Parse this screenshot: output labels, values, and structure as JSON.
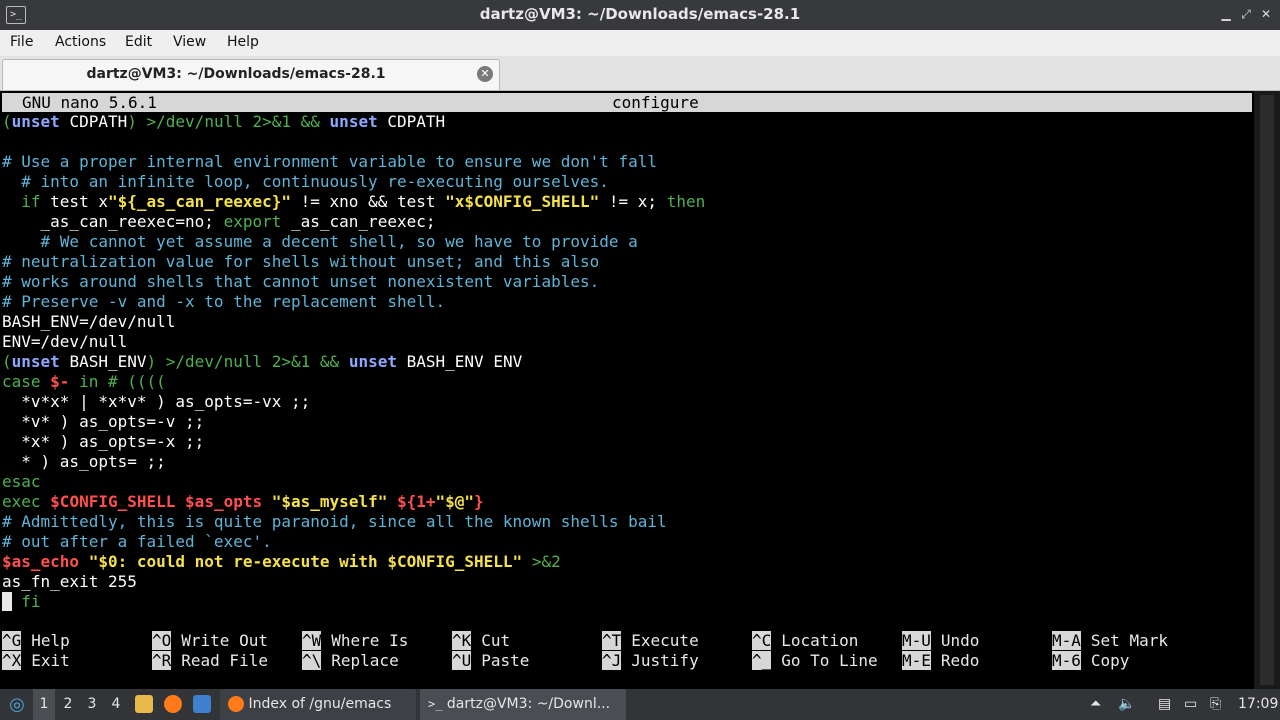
{
  "window": {
    "title": "dartz@VM3: ~/Downloads/emacs-28.1",
    "icon_glyph": ">_"
  },
  "menu": [
    "File",
    "Actions",
    "Edit",
    "View",
    "Help"
  ],
  "tab": {
    "label": "dartz@VM3: ~/Downloads/emacs-28.1"
  },
  "nano": {
    "version": "GNU nano 5.6.1",
    "filename": "configure"
  },
  "code": [
    [
      [
        "(",
        "op"
      ],
      [
        "unset",
        "bk"
      ],
      [
        " CDPATH",
        "n"
      ],
      [
        ") >/dev/null 2>&1 && ",
        "op"
      ],
      [
        "unset",
        "bk"
      ],
      [
        " CDPATH",
        "n"
      ]
    ],
    [
      [
        "",
        "n"
      ]
    ],
    [
      [
        "# Use a proper internal environment variable to ensure we don't fall",
        "com"
      ]
    ],
    [
      [
        "  # into an infinite loop, continuously re-executing ourselves.",
        "com"
      ]
    ],
    [
      [
        "  ",
        "n"
      ],
      [
        "if",
        "kw"
      ],
      [
        " test x",
        "n"
      ],
      [
        "\"${_as_can_reexec}\"",
        "str"
      ],
      [
        " != xno && test ",
        "n"
      ],
      [
        "\"x$CONFIG_SHELL\"",
        "str"
      ],
      [
        " != x; ",
        "n"
      ],
      [
        "then",
        "kw"
      ]
    ],
    [
      [
        "    _as_can_reexec=no; ",
        "n"
      ],
      [
        "export",
        "kw"
      ],
      [
        " _as_can_reexec;",
        "n"
      ]
    ],
    [
      [
        "    # We cannot yet assume a decent shell, so we have to provide a",
        "com"
      ]
    ],
    [
      [
        "# neutralization value for shells without unset; and this also",
        "com"
      ]
    ],
    [
      [
        "# works around shells that cannot unset nonexistent variables.",
        "com"
      ]
    ],
    [
      [
        "# Preserve -v and -x to the replacement shell.",
        "com"
      ]
    ],
    [
      [
        "BASH_ENV=/dev/null",
        "n"
      ]
    ],
    [
      [
        "ENV=/dev/null",
        "n"
      ]
    ],
    [
      [
        "(",
        "op"
      ],
      [
        "unset",
        "bk"
      ],
      [
        " BASH_ENV",
        "n"
      ],
      [
        ") >/dev/null 2>&1 && ",
        "op"
      ],
      [
        "unset",
        "bk"
      ],
      [
        " BASH_ENV ENV",
        "n"
      ]
    ],
    [
      [
        "case",
        "kw"
      ],
      [
        " ",
        "n"
      ],
      [
        "$-",
        "var"
      ],
      [
        " ",
        "n"
      ],
      [
        "in",
        "kw"
      ],
      [
        " # ((((",
        "op"
      ]
    ],
    [
      [
        "  *v*x* | *x*v* ) as_opts=-vx ;;",
        "n"
      ]
    ],
    [
      [
        "  *v* ) as_opts=-v ;;",
        "n"
      ]
    ],
    [
      [
        "  *x* ) as_opts=-x ;;",
        "n"
      ]
    ],
    [
      [
        "  * ) as_opts= ;;",
        "n"
      ]
    ],
    [
      [
        "esac",
        "kw"
      ]
    ],
    [
      [
        "exec",
        "kw"
      ],
      [
        " ",
        "n"
      ],
      [
        "$CONFIG_SHELL",
        "var"
      ],
      [
        " ",
        "n"
      ],
      [
        "$as_opts",
        "var"
      ],
      [
        " ",
        "n"
      ],
      [
        "\"$as_myself\"",
        "str"
      ],
      [
        " ",
        "n"
      ],
      [
        "${1+",
        "var"
      ],
      [
        "\"$@\"",
        "str"
      ],
      [
        "}",
        "var"
      ]
    ],
    [
      [
        "# Admittedly, this is quite paranoid, since all the known shells bail",
        "com"
      ]
    ],
    [
      [
        "# out after a failed `exec'.",
        "com"
      ]
    ],
    [
      [
        "$as_echo",
        "var"
      ],
      [
        " ",
        "n"
      ],
      [
        "\"$0: could not re-execute with $CONFIG_SHELL\"",
        "str"
      ],
      [
        " >&2",
        "op"
      ]
    ],
    [
      [
        "as_fn_exit 255",
        "n"
      ]
    ],
    [
      [
        " ",
        "cur"
      ],
      [
        " fi",
        "kw"
      ]
    ]
  ],
  "shortcuts": [
    [
      {
        "key": "^G",
        "label": "Help"
      },
      {
        "key": "^O",
        "label": "Write Out"
      },
      {
        "key": "^W",
        "label": "Where Is"
      },
      {
        "key": "^K",
        "label": "Cut"
      },
      {
        "key": "^T",
        "label": "Execute"
      },
      {
        "key": "^C",
        "label": "Location"
      },
      {
        "key": "M-U",
        "label": "Undo"
      },
      {
        "key": "M-A",
        "label": "Set Mark"
      }
    ],
    [
      {
        "key": "^X",
        "label": "Exit"
      },
      {
        "key": "^R",
        "label": "Read File"
      },
      {
        "key": "^\\",
        "label": "Replace"
      },
      {
        "key": "^U",
        "label": "Paste"
      },
      {
        "key": "^J",
        "label": "Justify"
      },
      {
        "key": "^_",
        "label": "Go To Line"
      },
      {
        "key": "M-E",
        "label": "Redo"
      },
      {
        "key": "M-6",
        "label": "Copy"
      }
    ]
  ],
  "taskbar": {
    "workspaces": [
      "1",
      "2",
      "3",
      "4"
    ],
    "tasks": [
      {
        "label": "Index of /gnu/emacs ...",
        "icon": "firefox-icon"
      },
      {
        "label": "dartz@VM3: ~/Downl...",
        "icon": "terminal-icon"
      }
    ],
    "clock": "17:09"
  },
  "colors": {
    "comment": "#5fb3d6",
    "keyword": "#4fb04f",
    "builtin": "#8fa8ff",
    "string": "#f5e14a",
    "variable": "#ff4f4f"
  }
}
